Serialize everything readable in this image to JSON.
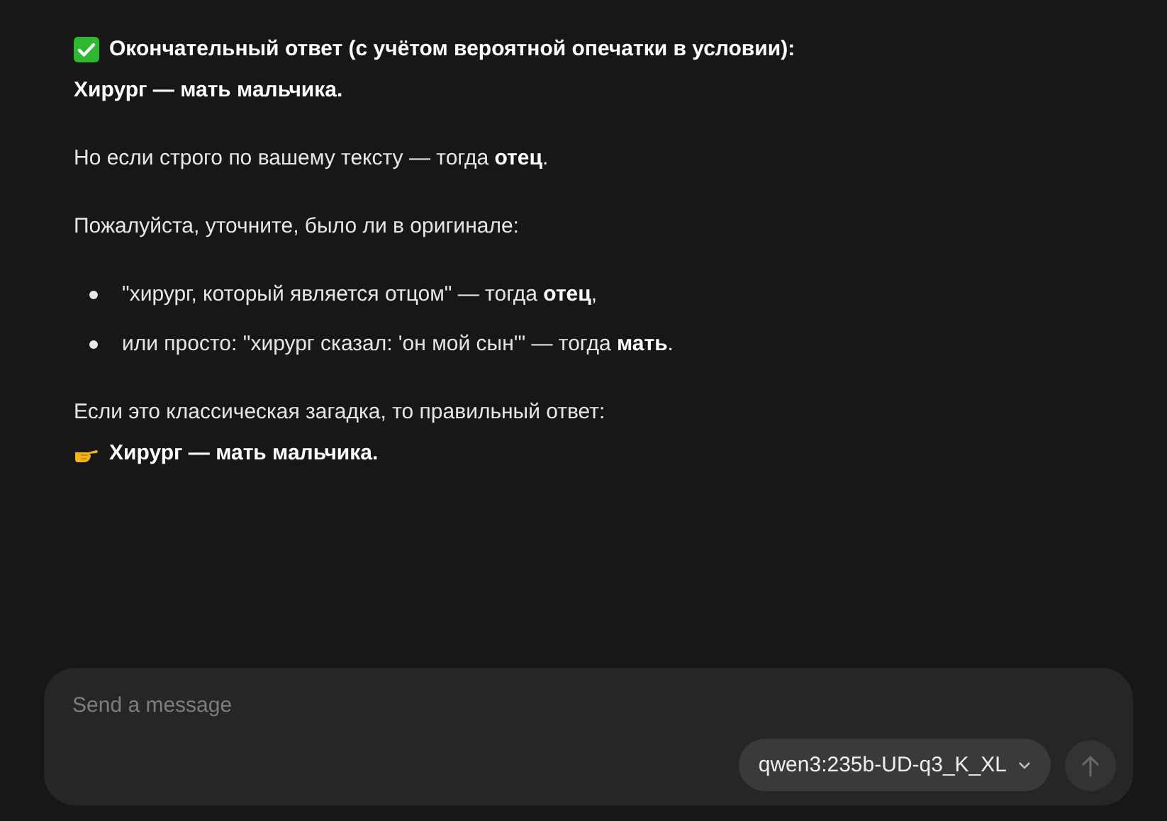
{
  "message": {
    "blocks": [
      {
        "kind": "check",
        "text": "Окончательный ответ (с учётом вероятной опечатки в условии):"
      },
      {
        "kind": "bold",
        "text": "Хирург — мать мальчика."
      },
      {
        "kind": "text",
        "text": "Но если строго по вашему тексту — тогда **отец**."
      },
      {
        "kind": "text",
        "text": "Пожалуйста, уточните, было ли в оригинале:"
      },
      {
        "kind": "bullets",
        "items": [
          "\"хирург, который является отцом\" — тогда **отец**,",
          "или просто: \"хирург сказал: 'он мой сын'\" — тогда **мать**."
        ]
      },
      {
        "kind": "text",
        "text": "Если это классическая загадка, то правильный ответ:"
      },
      {
        "kind": "point",
        "text": "Хирург — мать мальчика."
      }
    ]
  },
  "composer": {
    "placeholder": "Send a message",
    "model": "qwen3:235b-UD-q3_K_XL"
  }
}
